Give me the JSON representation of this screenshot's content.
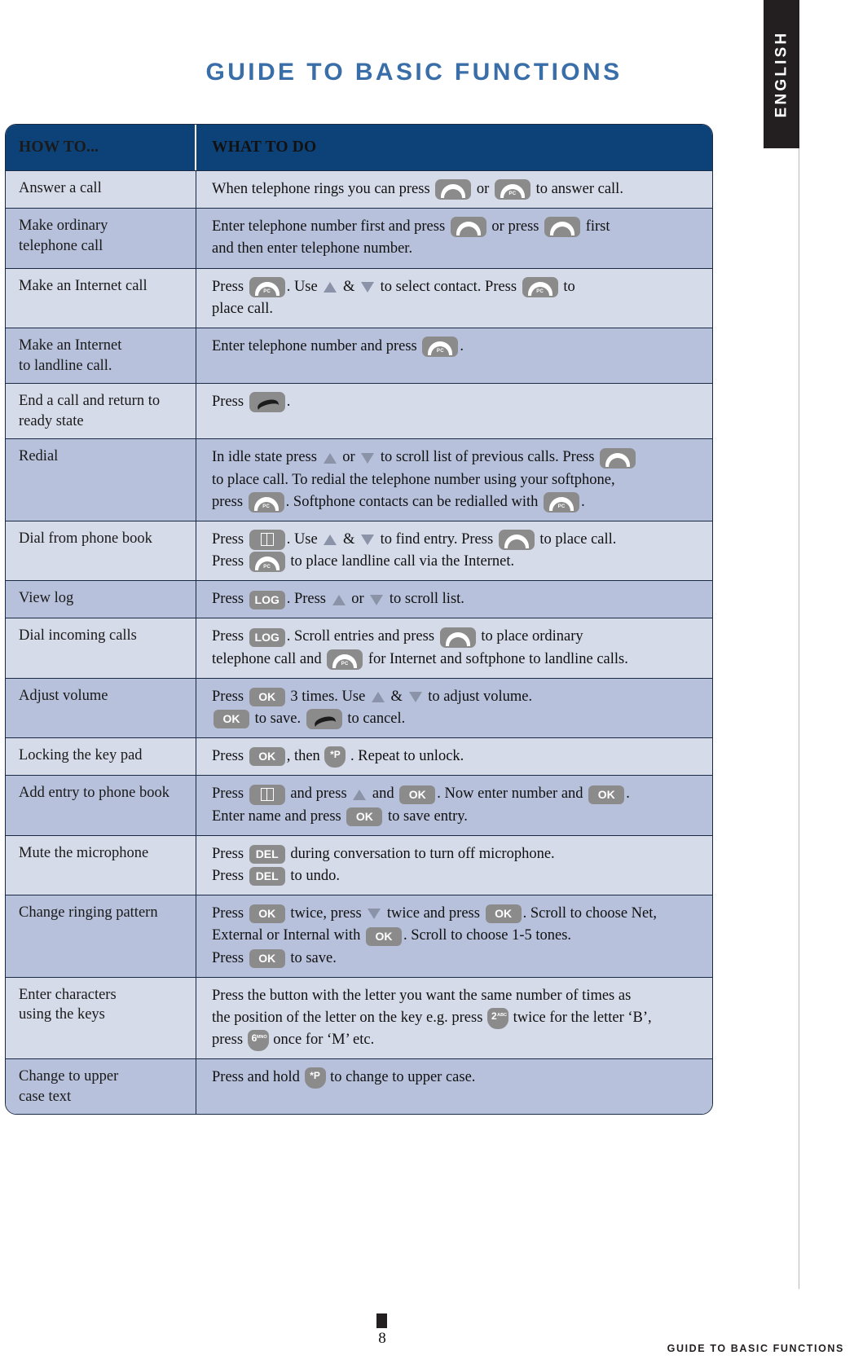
{
  "language_tab": {
    "label": "ENGLISH"
  },
  "page_title": "GUIDE TO BASIC FUNCTIONS",
  "colors": {
    "title_blue": "#3a6ea8",
    "header_navy": "#0d4279",
    "row_light": "#d6dbe9",
    "row_dark": "#b7c1db",
    "key_grey": "#8b8b8b",
    "tab_black": "#231f20",
    "border": "#1a2a44"
  },
  "table": {
    "headers": {
      "how": "HOW TO...",
      "what": "WHAT TO DO"
    },
    "rows": [
      {
        "how": [
          "Answer a call"
        ],
        "what_lines": [
          [
            {
              "t": "text",
              "v": "When telephone rings you can press "
            },
            {
              "t": "key",
              "kind": "phone",
              "label": ""
            },
            {
              "t": "text",
              "v": " or "
            },
            {
              "t": "key",
              "kind": "phone-pc",
              "label": "PC"
            },
            {
              "t": "text",
              "v": " to answer call."
            }
          ]
        ]
      },
      {
        "how": [
          "Make ordinary",
          "telephone call"
        ],
        "what_lines": [
          [
            {
              "t": "text",
              "v": "Enter telephone number first and press "
            },
            {
              "t": "key",
              "kind": "phone",
              "label": ""
            },
            {
              "t": "text",
              "v": " or press "
            },
            {
              "t": "key",
              "kind": "phone",
              "label": ""
            },
            {
              "t": "text",
              "v": " first"
            }
          ],
          [
            {
              "t": "text",
              "v": "and then enter telephone number."
            }
          ]
        ]
      },
      {
        "how": [
          "Make an Internet call"
        ],
        "what_lines": [
          [
            {
              "t": "text",
              "v": "Press "
            },
            {
              "t": "key",
              "kind": "phone-pc",
              "label": "PC"
            },
            {
              "t": "text",
              "v": ". Use "
            },
            {
              "t": "arrow",
              "dir": "up"
            },
            {
              "t": "text",
              "v": " & "
            },
            {
              "t": "arrow",
              "dir": "down"
            },
            {
              "t": "text",
              "v": " to select contact. Press "
            },
            {
              "t": "key",
              "kind": "phone-pc",
              "label": "PC"
            },
            {
              "t": "text",
              "v": " to"
            }
          ],
          [
            {
              "t": "text",
              "v": "place call."
            }
          ]
        ]
      },
      {
        "how": [
          "Make an Internet",
          "to landline call."
        ],
        "what_lines": [
          [
            {
              "t": "text",
              "v": "Enter telephone number and press "
            },
            {
              "t": "key",
              "kind": "phone-pc",
              "label": "PC"
            },
            {
              "t": "text",
              "v": "."
            }
          ]
        ]
      },
      {
        "how": [
          "End a call and return to",
          "ready state"
        ],
        "what_lines": [
          [
            {
              "t": "text",
              "v": "Press "
            },
            {
              "t": "key",
              "kind": "endcall",
              "label": ""
            },
            {
              "t": "text",
              "v": "."
            }
          ]
        ]
      },
      {
        "how": [
          "Redial"
        ],
        "what_lines": [
          [
            {
              "t": "text",
              "v": "In idle state press "
            },
            {
              "t": "arrow",
              "dir": "up"
            },
            {
              "t": "text",
              "v": " or "
            },
            {
              "t": "arrow",
              "dir": "down"
            },
            {
              "t": "text",
              "v": " to scroll list of previous calls. Press "
            },
            {
              "t": "key",
              "kind": "phone",
              "label": ""
            }
          ],
          [
            {
              "t": "text",
              "v": "to place call. To redial the telephone number using your softphone,"
            }
          ],
          [
            {
              "t": "text",
              "v": "press "
            },
            {
              "t": "key",
              "kind": "phone-pc",
              "label": "PC"
            },
            {
              "t": "text",
              "v": ". Softphone contacts can be redialled with "
            },
            {
              "t": "key",
              "kind": "phone-pc",
              "label": "PC"
            },
            {
              "t": "text",
              "v": "."
            }
          ]
        ]
      },
      {
        "how": [
          "Dial from phone book"
        ],
        "what_lines": [
          [
            {
              "t": "text",
              "v": "Press "
            },
            {
              "t": "key",
              "kind": "book",
              "label": ""
            },
            {
              "t": "text",
              "v": ". Use "
            },
            {
              "t": "arrow",
              "dir": "up"
            },
            {
              "t": "text",
              "v": " & "
            },
            {
              "t": "arrow",
              "dir": "down"
            },
            {
              "t": "text",
              "v": " to find entry. Press "
            },
            {
              "t": "key",
              "kind": "phone",
              "label": ""
            },
            {
              "t": "text",
              "v": " to place call."
            }
          ],
          [
            {
              "t": "text",
              "v": "Press "
            },
            {
              "t": "key",
              "kind": "phone-pc",
              "label": "PC"
            },
            {
              "t": "text",
              "v": " to place landline call via the Internet."
            }
          ]
        ]
      },
      {
        "how": [
          "View log"
        ],
        "what_lines": [
          [
            {
              "t": "text",
              "v": "Press "
            },
            {
              "t": "key",
              "kind": "rect",
              "label": "LOG"
            },
            {
              "t": "text",
              "v": ". Press "
            },
            {
              "t": "arrow",
              "dir": "up"
            },
            {
              "t": "text",
              "v": " or "
            },
            {
              "t": "arrow",
              "dir": "down"
            },
            {
              "t": "text",
              "v": " to scroll list."
            }
          ]
        ]
      },
      {
        "how": [
          "Dial incoming calls"
        ],
        "what_lines": [
          [
            {
              "t": "text",
              "v": "Press "
            },
            {
              "t": "key",
              "kind": "rect",
              "label": "LOG"
            },
            {
              "t": "text",
              "v": ". Scroll entries and press "
            },
            {
              "t": "key",
              "kind": "phone",
              "label": ""
            },
            {
              "t": "text",
              "v": " to place ordinary"
            }
          ],
          [
            {
              "t": "text",
              "v": "telephone call and "
            },
            {
              "t": "key",
              "kind": "phone-pc",
              "label": "PC"
            },
            {
              "t": "text",
              "v": " for Internet and softphone to landline calls."
            }
          ]
        ]
      },
      {
        "how": [
          "Adjust volume"
        ],
        "what_lines": [
          [
            {
              "t": "text",
              "v": "Press "
            },
            {
              "t": "key",
              "kind": "rect",
              "label": "OK"
            },
            {
              "t": "text",
              "v": " 3 times. Use "
            },
            {
              "t": "arrow",
              "dir": "up"
            },
            {
              "t": "text",
              "v": " & "
            },
            {
              "t": "arrow",
              "dir": "down"
            },
            {
              "t": "text",
              "v": " to adjust volume."
            }
          ],
          [
            {
              "t": "key",
              "kind": "rect",
              "label": "OK"
            },
            {
              "t": "text",
              "v": " to save. "
            },
            {
              "t": "key",
              "kind": "endcall",
              "label": ""
            },
            {
              "t": "text",
              "v": " to cancel."
            }
          ]
        ]
      },
      {
        "how": [
          "Locking the key pad"
        ],
        "what_lines": [
          [
            {
              "t": "text",
              "v": "Press "
            },
            {
              "t": "key",
              "kind": "rect",
              "label": "OK"
            },
            {
              "t": "text",
              "v": ", then "
            },
            {
              "t": "key",
              "kind": "shield",
              "label": "*P",
              "sub": ""
            },
            {
              "t": "text",
              "v": " . Repeat to unlock."
            }
          ]
        ]
      },
      {
        "how": [
          "Add entry to phone book"
        ],
        "what_lines": [
          [
            {
              "t": "text",
              "v": "Press "
            },
            {
              "t": "key",
              "kind": "book",
              "label": ""
            },
            {
              "t": "text",
              "v": " and press "
            },
            {
              "t": "arrow",
              "dir": "up"
            },
            {
              "t": "text",
              "v": " and "
            },
            {
              "t": "key",
              "kind": "rect",
              "label": "OK"
            },
            {
              "t": "text",
              "v": ". Now enter number and "
            },
            {
              "t": "key",
              "kind": "rect",
              "label": "OK"
            },
            {
              "t": "text",
              "v": "."
            }
          ],
          [
            {
              "t": "text",
              "v": "Enter name and press "
            },
            {
              "t": "key",
              "kind": "rect",
              "label": "OK"
            },
            {
              "t": "text",
              "v": " to save entry."
            }
          ]
        ]
      },
      {
        "how": [
          "Mute the microphone"
        ],
        "what_lines": [
          [
            {
              "t": "text",
              "v": "Press "
            },
            {
              "t": "key",
              "kind": "rect",
              "label": "DEL"
            },
            {
              "t": "text",
              "v": " during conversation to turn off microphone."
            }
          ],
          [
            {
              "t": "text",
              "v": "Press "
            },
            {
              "t": "key",
              "kind": "rect",
              "label": "DEL"
            },
            {
              "t": "text",
              "v": " to undo."
            }
          ]
        ]
      },
      {
        "how": [
          "Change ringing pattern"
        ],
        "what_lines": [
          [
            {
              "t": "text",
              "v": "Press "
            },
            {
              "t": "key",
              "kind": "rect",
              "label": "OK"
            },
            {
              "t": "text",
              "v": " twice, press "
            },
            {
              "t": "arrow",
              "dir": "down"
            },
            {
              "t": "text",
              "v": " twice and press "
            },
            {
              "t": "key",
              "kind": "rect",
              "label": "OK"
            },
            {
              "t": "text",
              "v": ". Scroll to choose Net,"
            }
          ],
          [
            {
              "t": "text",
              "v": "External or Internal with "
            },
            {
              "t": "key",
              "kind": "rect",
              "label": "OK"
            },
            {
              "t": "text",
              "v": ". Scroll to choose 1-5 tones."
            }
          ],
          [
            {
              "t": "text",
              "v": "Press "
            },
            {
              "t": "key",
              "kind": "rect",
              "label": "OK"
            },
            {
              "t": "text",
              "v": " to save."
            }
          ]
        ]
      },
      {
        "how": [
          "Enter characters",
          "using the keys"
        ],
        "what_lines": [
          [
            {
              "t": "text",
              "v": "Press the button with the letter you want the same number of times as"
            }
          ],
          [
            {
              "t": "text",
              "v": "the position of the letter on the key e.g. press "
            },
            {
              "t": "key",
              "kind": "shield",
              "label": "2",
              "sub": "ABC"
            },
            {
              "t": "text",
              "v": " twice for the letter ‘B’,"
            }
          ],
          [
            {
              "t": "text",
              "v": "press "
            },
            {
              "t": "key",
              "kind": "shield",
              "label": "6",
              "sub": "MNO"
            },
            {
              "t": "text",
              "v": " once for ‘M’ etc."
            }
          ]
        ]
      },
      {
        "how": [
          "Change to upper",
          "case text"
        ],
        "what_lines": [
          [
            {
              "t": "text",
              "v": "Press and hold "
            },
            {
              "t": "key",
              "kind": "shield",
              "label": "*P",
              "sub": ""
            },
            {
              "t": "text",
              "v": " to change to upper case."
            }
          ]
        ]
      }
    ]
  },
  "footer": {
    "page_number": "8",
    "footer_text": "GUIDE TO BASIC FUNCTIONS"
  }
}
